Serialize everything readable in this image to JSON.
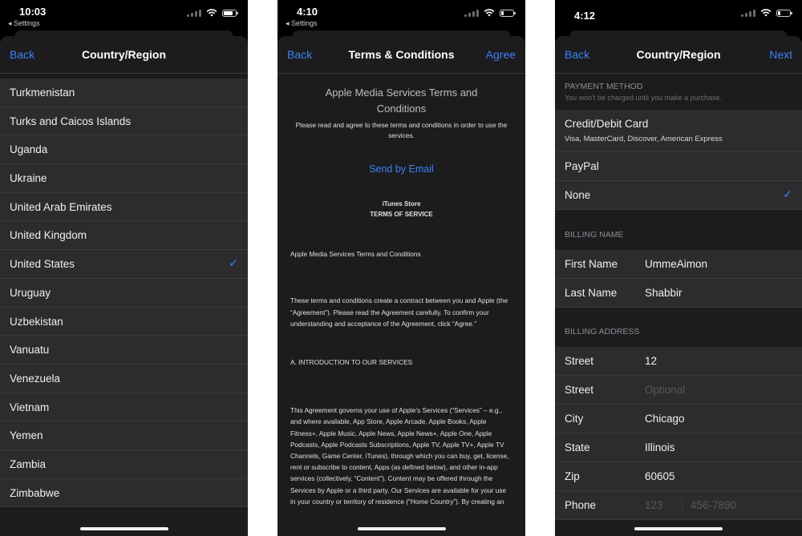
{
  "screen1": {
    "time": "10:03",
    "back_app": "◂ Settings",
    "nav": {
      "back": "Back",
      "title": "Country/Region"
    },
    "countries": [
      "Turkmenistan",
      "Turks and Caicos Islands",
      "Uganda",
      "Ukraine",
      "United Arab Emirates",
      "United Kingdom",
      "United States",
      "Uruguay",
      "Uzbekistan",
      "Vanuatu",
      "Venezuela",
      "Vietnam",
      "Yemen",
      "Zambia",
      "Zimbabwe"
    ],
    "selected": "United States",
    "battery_fraction": 0.75
  },
  "screen2": {
    "time": "4:10",
    "back_app": "◂ Settings",
    "nav": {
      "back": "Back",
      "title": "Terms & Conditions",
      "action": "Agree"
    },
    "heading": "Apple Media Services Terms and Conditions",
    "intro": "Please read and agree to these terms and conditions in order to use the services.",
    "email_link": "Send by Email",
    "store_line1": "iTunes Store",
    "store_line2": "TERMS OF SERVICE",
    "para1": "Apple Media Services Terms and Conditions",
    "para2": "These terms and conditions create a contract between you and Apple (the “Agreement”). Please read the Agreement carefully. To confirm your understanding and acceptance of the Agreement, click “Agree.”",
    "para3": "A. INTRODUCTION TO OUR SERVICES",
    "para4": "This Agreement governs your use of Apple’s Services (“Services” – e.g., and where available, App Store, Apple Arcade, Apple Books, Apple Fitness+, Apple Music, Apple News, Apple News+, Apple One, Apple Podcasts, Apple Podcasts Subscriptions, Apple TV, Apple TV+, Apple TV Channels, Game Center, iTunes), through which you can buy, get, license, rent or subscribe to content, Apps (as defined below), and other in-app services (collectively, “Content”). Content may be offered through the Services by Apple or a third party. Our Services are available for your use in your country or territory of residence (“Home Country”). By creating an",
    "battery_fraction": 0.2
  },
  "screen3": {
    "time": "4:12",
    "nav": {
      "back": "Back",
      "title": "Country/Region",
      "action": "Next"
    },
    "payment_header": "PAYMENT METHOD",
    "payment_sub": "You won't be charged until you make a purchase.",
    "card_label": "Credit/Debit Card",
    "card_sub": "Visa, MasterCard, Discover, American Express",
    "paypal": "PayPal",
    "none": "None",
    "billing_name_header": "BILLING NAME",
    "first_name_label": "First Name",
    "first_name": "UmmeAimon",
    "last_name_label": "Last Name",
    "last_name": "Shabbir",
    "billing_address_header": "BILLING ADDRESS",
    "street_label": "Street",
    "street": "12",
    "street2_label": "Street",
    "street2_placeholder": "Optional",
    "city_label": "City",
    "city": "Chicago",
    "state_label": "State",
    "state": "Illinois",
    "zip_label": "Zip",
    "zip": "60605",
    "phone_label": "Phone",
    "phone_area_placeholder": "123",
    "phone_number_placeholder": "456-7890",
    "battery_fraction": 0.2
  },
  "colors": {
    "accent": "#3b82f6",
    "cell": "#2c2c2e",
    "sheet": "#1c1c1e"
  }
}
